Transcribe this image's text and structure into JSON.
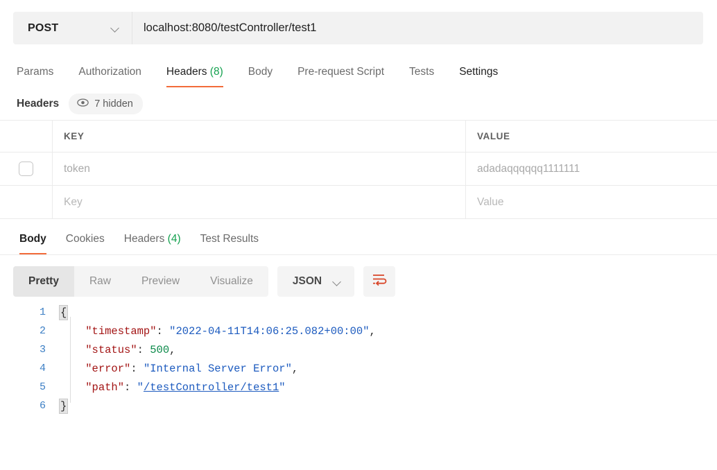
{
  "theme": {
    "accent": "#f26b3a",
    "count_green": "#14a14f",
    "linenum_blue": "#3b7ec4"
  },
  "request": {
    "method": "POST",
    "url": "localhost:8080/testController/test1",
    "method_chevron_icon": "chevron-down-icon",
    "tabs": [
      {
        "label": "Params",
        "active": false,
        "count": ""
      },
      {
        "label": "Authorization",
        "active": false,
        "count": ""
      },
      {
        "label": "Headers",
        "active": true,
        "count": "(8)"
      },
      {
        "label": "Body",
        "active": false,
        "count": ""
      },
      {
        "label": "Pre-request Script",
        "active": false,
        "count": ""
      },
      {
        "label": "Tests",
        "active": false,
        "count": ""
      },
      {
        "label": "Settings",
        "active": false,
        "count": ""
      }
    ]
  },
  "headers_section": {
    "title": "Headers",
    "hidden_pill": {
      "icon": "eye-icon",
      "label": "7 hidden"
    },
    "columns": [
      "KEY",
      "VALUE"
    ],
    "rows": [
      {
        "checked": false,
        "key": "token",
        "value": "adadaqqqqqq1111111",
        "placeholder": false
      },
      {
        "checked": false,
        "key": "Key",
        "value": "Value",
        "placeholder": true
      }
    ]
  },
  "response": {
    "tabs": [
      {
        "label": "Body",
        "active": true,
        "count": ""
      },
      {
        "label": "Cookies",
        "active": false,
        "count": ""
      },
      {
        "label": "Headers",
        "active": false,
        "count": "(4)"
      },
      {
        "label": "Test Results",
        "active": false,
        "count": ""
      }
    ],
    "view_modes": [
      {
        "label": "Pretty",
        "active": true
      },
      {
        "label": "Raw",
        "active": false
      },
      {
        "label": "Preview",
        "active": false
      },
      {
        "label": "Visualize",
        "active": false
      }
    ],
    "format": {
      "label": "JSON",
      "chevron_icon": "chevron-down-icon"
    },
    "wrap_button": {
      "icon": "wrap-lines-icon"
    },
    "body": {
      "language": "json",
      "line_numbers": [
        1,
        2,
        3,
        4,
        5,
        6
      ],
      "json": {
        "timestamp": "2022-04-11T14:06:25.082+00:00",
        "status": 500,
        "error": "Internal Server Error",
        "path": "/testController/test1"
      },
      "lines": [
        {
          "num": "1",
          "tokens": [
            {
              "t": "brace",
              "v": "{"
            }
          ]
        },
        {
          "num": "2",
          "tokens": [
            {
              "t": "p",
              "v": "    "
            },
            {
              "t": "k",
              "v": "\"timestamp\""
            },
            {
              "t": "p",
              "v": ": "
            },
            {
              "t": "s",
              "v": "\"2022-04-11T14:06:25.082+00:00\""
            },
            {
              "t": "p",
              "v": ","
            }
          ]
        },
        {
          "num": "3",
          "tokens": [
            {
              "t": "p",
              "v": "    "
            },
            {
              "t": "k",
              "v": "\"status\""
            },
            {
              "t": "p",
              "v": ": "
            },
            {
              "t": "n",
              "v": "500"
            },
            {
              "t": "p",
              "v": ","
            }
          ]
        },
        {
          "num": "4",
          "tokens": [
            {
              "t": "p",
              "v": "    "
            },
            {
              "t": "k",
              "v": "\"error\""
            },
            {
              "t": "p",
              "v": ": "
            },
            {
              "t": "s",
              "v": "\"Internal Server Error\""
            },
            {
              "t": "p",
              "v": ","
            }
          ]
        },
        {
          "num": "5",
          "tokens": [
            {
              "t": "p",
              "v": "    "
            },
            {
              "t": "k",
              "v": "\"path\""
            },
            {
              "t": "p",
              "v": ": "
            },
            {
              "t": "s",
              "v": "\""
            },
            {
              "t": "lnk",
              "v": "/testController/test1"
            },
            {
              "t": "s",
              "v": "\""
            }
          ]
        },
        {
          "num": "6",
          "tokens": [
            {
              "t": "brace",
              "v": "}"
            }
          ]
        }
      ]
    }
  }
}
